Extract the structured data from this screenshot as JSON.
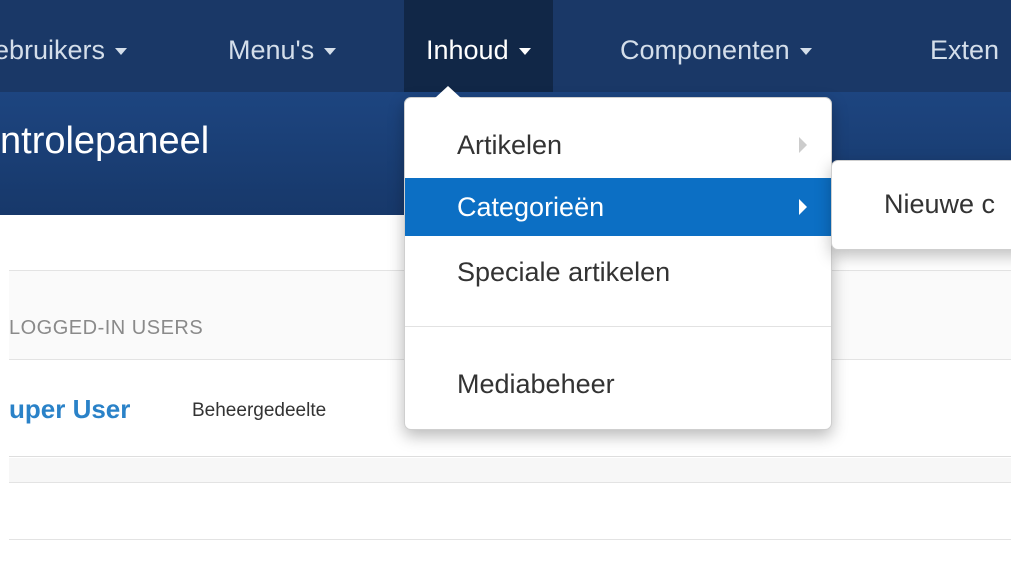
{
  "navbar": {
    "items": [
      {
        "label": "ebruikers"
      },
      {
        "label": "Menu's"
      },
      {
        "label": "Inhoud"
      },
      {
        "label": "Componenten"
      },
      {
        "label": "Exten"
      }
    ]
  },
  "page": {
    "title": "ntrolepaneel"
  },
  "dropdown": {
    "items": [
      {
        "label": "Artikelen"
      },
      {
        "label": "Categorieën"
      },
      {
        "label": "Speciale artikelen"
      },
      {
        "label": "Mediabeheer"
      }
    ]
  },
  "submenu": {
    "items": [
      {
        "label": "Nieuwe c"
      }
    ]
  },
  "panel": {
    "header": "LOGGED-IN USERS",
    "user_name": "uper User",
    "user_area": "Beheergedeelte"
  },
  "colors": {
    "navbar": "#1a3867",
    "header": "#1d4580",
    "active_menu": "#0c6fc4",
    "link": "#2a82c8"
  }
}
